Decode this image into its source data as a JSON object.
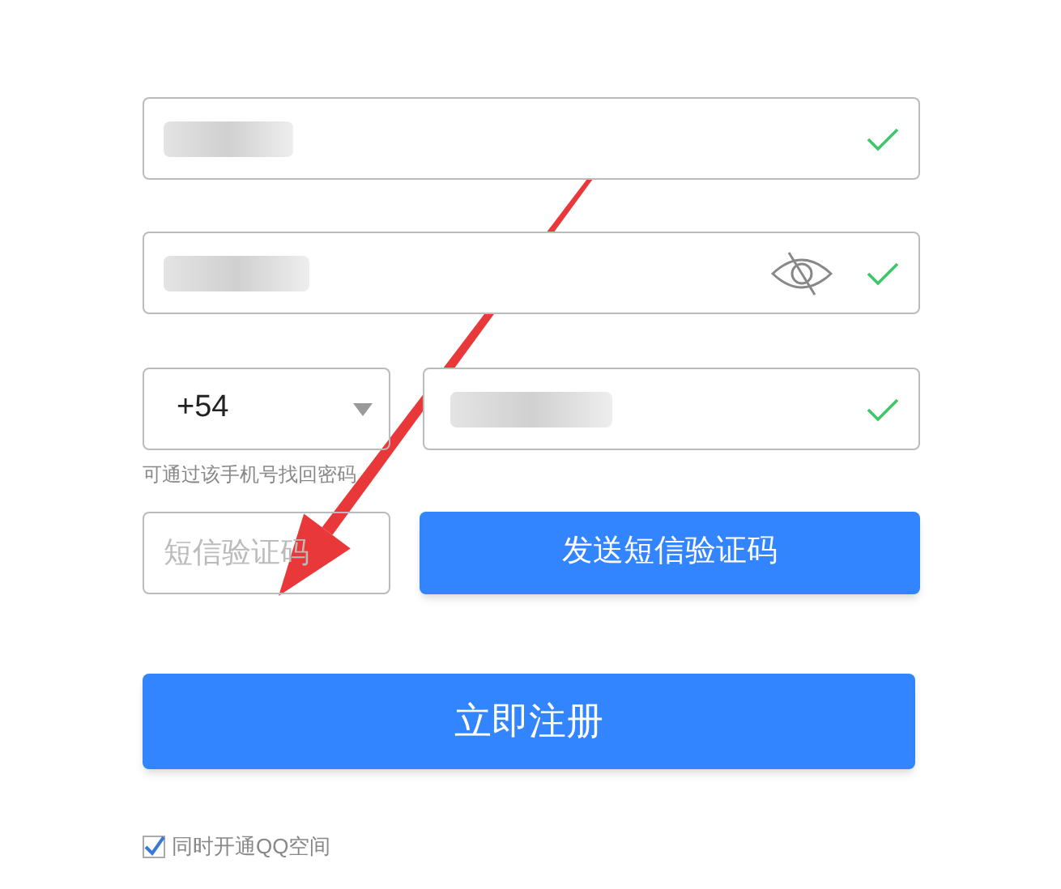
{
  "fields": [
    {
      "kind": "text",
      "valid": true,
      "redacted": true
    },
    {
      "kind": "password",
      "valid": true,
      "redacted": true,
      "password_hidden": true
    }
  ],
  "phone": {
    "country_code": "+54",
    "valid": true,
    "redacted": true,
    "hint": "可通过该手机号找回密码"
  },
  "sms": {
    "placeholder": "短信验证码",
    "send_button": "发送短信验证码"
  },
  "register_button": "立即注册",
  "qzone": {
    "label": "同时开通QQ空间",
    "checked": true
  }
}
